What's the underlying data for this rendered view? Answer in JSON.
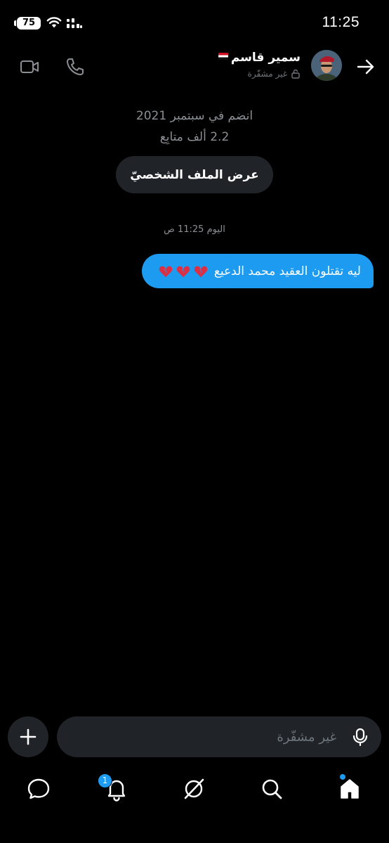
{
  "status_bar": {
    "time": "11:25",
    "battery": "75"
  },
  "header": {
    "contact_name": "سمير قاسم",
    "encryption_status": "غير مشفّرة",
    "icons": [
      "video-call-icon",
      "phone-call-icon",
      "lock-icon",
      "back-arrow-icon"
    ]
  },
  "profile": {
    "joined": "انضم في سبتمبر 2021",
    "followers": "2.2 ألف متابِع",
    "view_profile_label": "عرض الملف الشخصيّ"
  },
  "conversation": {
    "timestamp": "اليوم 11:25 ص",
    "messages": [
      {
        "text": "ليه تقتلون العقيد محمد الدعيع",
        "emoji": [
          "broken-heart",
          "broken-heart",
          "broken-heart"
        ]
      }
    ]
  },
  "composer": {
    "placeholder": "غير مشفّرة"
  },
  "bottom_nav": {
    "items": [
      "messages-icon",
      "notifications-icon",
      "grok-icon",
      "search-icon",
      "home-icon"
    ],
    "notification_count": "1"
  },
  "colors": {
    "background": "#000000",
    "accent": "#1d9bf0",
    "surface": "#202327",
    "muted_text": "#8b8f94"
  }
}
